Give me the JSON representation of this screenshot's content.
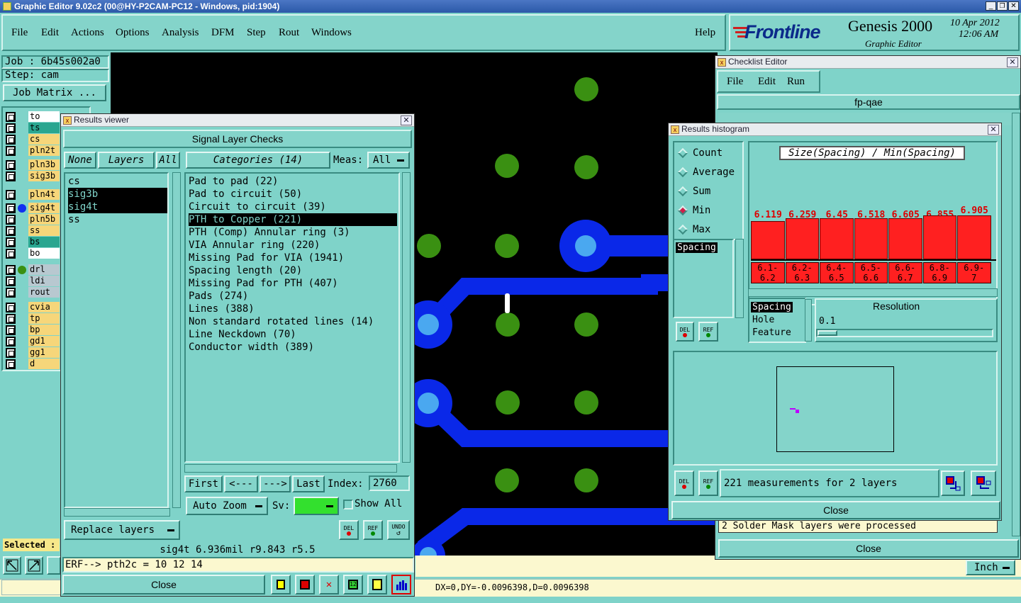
{
  "window": {
    "title": "Graphic Editor 9.02c2 (00@HY-P2CAM-PC12 - Windows, pid:1904)"
  },
  "menu": {
    "items": [
      "File",
      "Edit",
      "Actions",
      "Options",
      "Analysis",
      "DFM",
      "Step",
      "Rout",
      "Windows"
    ],
    "help": "Help"
  },
  "brand": {
    "logo": "Frontline",
    "product": "Genesis 2000",
    "subtitle": "Graphic Editor",
    "date": "10 Apr 2012",
    "time": "12:06 AM"
  },
  "job": {
    "job_label": "Job : 6b45s002a0",
    "step_label": "Step: cam",
    "matrix_button": "Job Matrix ..."
  },
  "layers": [
    {
      "name": "to",
      "color": "#ffffff"
    },
    {
      "name": "ts",
      "color": "#2aa690"
    },
    {
      "name": "cs",
      "color": "#f6d67a"
    },
    {
      "name": "pln2t",
      "color": "#f6d67a"
    },
    {
      "name": "pln3b",
      "color": "#f6d67a"
    },
    {
      "name": "sig3b",
      "color": "#f6d67a"
    },
    {
      "name": "pln4t",
      "color": "#f6d67a"
    },
    {
      "name": "sig4t",
      "color": "#f6d67a"
    },
    {
      "name": "pln5b",
      "color": "#f6d67a"
    },
    {
      "name": "ss",
      "color": "#f6d67a"
    },
    {
      "name": "bs",
      "color": "#2aa690"
    },
    {
      "name": "bo",
      "color": "#ffffff"
    },
    {
      "name": "drl",
      "color": "#b8c8d0"
    },
    {
      "name": "ldi",
      "color": "#b8c8d0"
    },
    {
      "name": "rout",
      "color": "#b8c8d0"
    },
    {
      "name": "cvia",
      "color": "#f6d67a"
    },
    {
      "name": "tp",
      "color": "#f6d67a"
    },
    {
      "name": "bp",
      "color": "#f6d67a"
    },
    {
      "name": "gd1",
      "color": "#f6d67a"
    },
    {
      "name": "gg1",
      "color": "#f6d67a"
    },
    {
      "name": "d",
      "color": "#f6d67a"
    }
  ],
  "selected_label": "Selected :",
  "results_viewer": {
    "title": "Results viewer",
    "header": "Signal Layer Checks",
    "none_btn": "None",
    "layers_btn": "Layers",
    "all_btn": "All",
    "categories_btn": "Categories (14)",
    "meas_label": "Meas:",
    "meas_value": "All",
    "layer_list": [
      "cs",
      "sig3b",
      "sig4t",
      "ss"
    ],
    "categories": [
      "Pad to pad (22)",
      "Pad to circuit (50)",
      "Circuit to circuit (39)",
      "PTH to Copper (221)",
      "PTH (Comp) Annular ring (3)",
      "VIA Annular ring (220)",
      "Missing Pad for VIA (1941)",
      "Spacing length (20)",
      "Missing Pad for PTH (407)",
      "Pads (274)",
      "Lines (388)",
      "Non standard rotated lines (14)",
      "Line Neckdown (70)",
      "Conductor width (389)"
    ],
    "first_btn": "First",
    "prev_btn": "<---",
    "next_btn": "--->",
    "last_btn": "Last",
    "index_label": "Index:",
    "index_value": "2760",
    "auto_zoom": "Auto Zoom",
    "sv_label": "Sv:",
    "show_all": "Show All",
    "replace_layers": "Replace layers",
    "del": "DEL",
    "ref": "REF",
    "undo": "UNDO",
    "status": "sig4t 6.936mil   r9.843  r5.5",
    "erf": "ERF--> pth2c = 10 12 14",
    "close": "Close"
  },
  "checklist": {
    "title": "Checklist Editor",
    "menu": [
      "File",
      "Edit",
      "Run"
    ],
    "name": "fp-qae",
    "message": "2 Solder Mask layers were processed",
    "close": "Close",
    "inch": "Inch"
  },
  "histogram": {
    "title": "Results histogram",
    "modes": [
      "Count",
      "Average",
      "Sum",
      "Min",
      "Max"
    ],
    "selected_mode": "Min",
    "header": "Size(Spacing) / Min(Spacing)",
    "list": [
      "Spacing"
    ],
    "bars": [
      {
        "value": "6.119",
        "range_top": "6.1-",
        "range_bottom": "6.2"
      },
      {
        "value": "6.259",
        "range_top": "6.2-",
        "range_bottom": "6.3"
      },
      {
        "value": "6.45",
        "range_top": "6.4-",
        "range_bottom": "6.5"
      },
      {
        "value": "6.518",
        "range_top": "6.5-",
        "range_bottom": "6.6"
      },
      {
        "value": "6.605",
        "range_top": "6.6-",
        "range_bottom": "6.7"
      },
      {
        "value": "6.855",
        "range_top": "6.8-",
        "range_bottom": "6.9"
      },
      {
        "value": "6.905",
        "range_top": "6.9-",
        "range_bottom": "7"
      }
    ],
    "attributes": [
      "Spacing",
      "Hole",
      "Feature"
    ],
    "resolution_label": "Resolution",
    "resolution_value": "0.1",
    "measurements": "221 measurements for 2 layers",
    "del": "DEL",
    "ref": "REF",
    "close": "Close"
  },
  "coords": "DX=0,DY=-0.0096398,D=0.0096398"
}
